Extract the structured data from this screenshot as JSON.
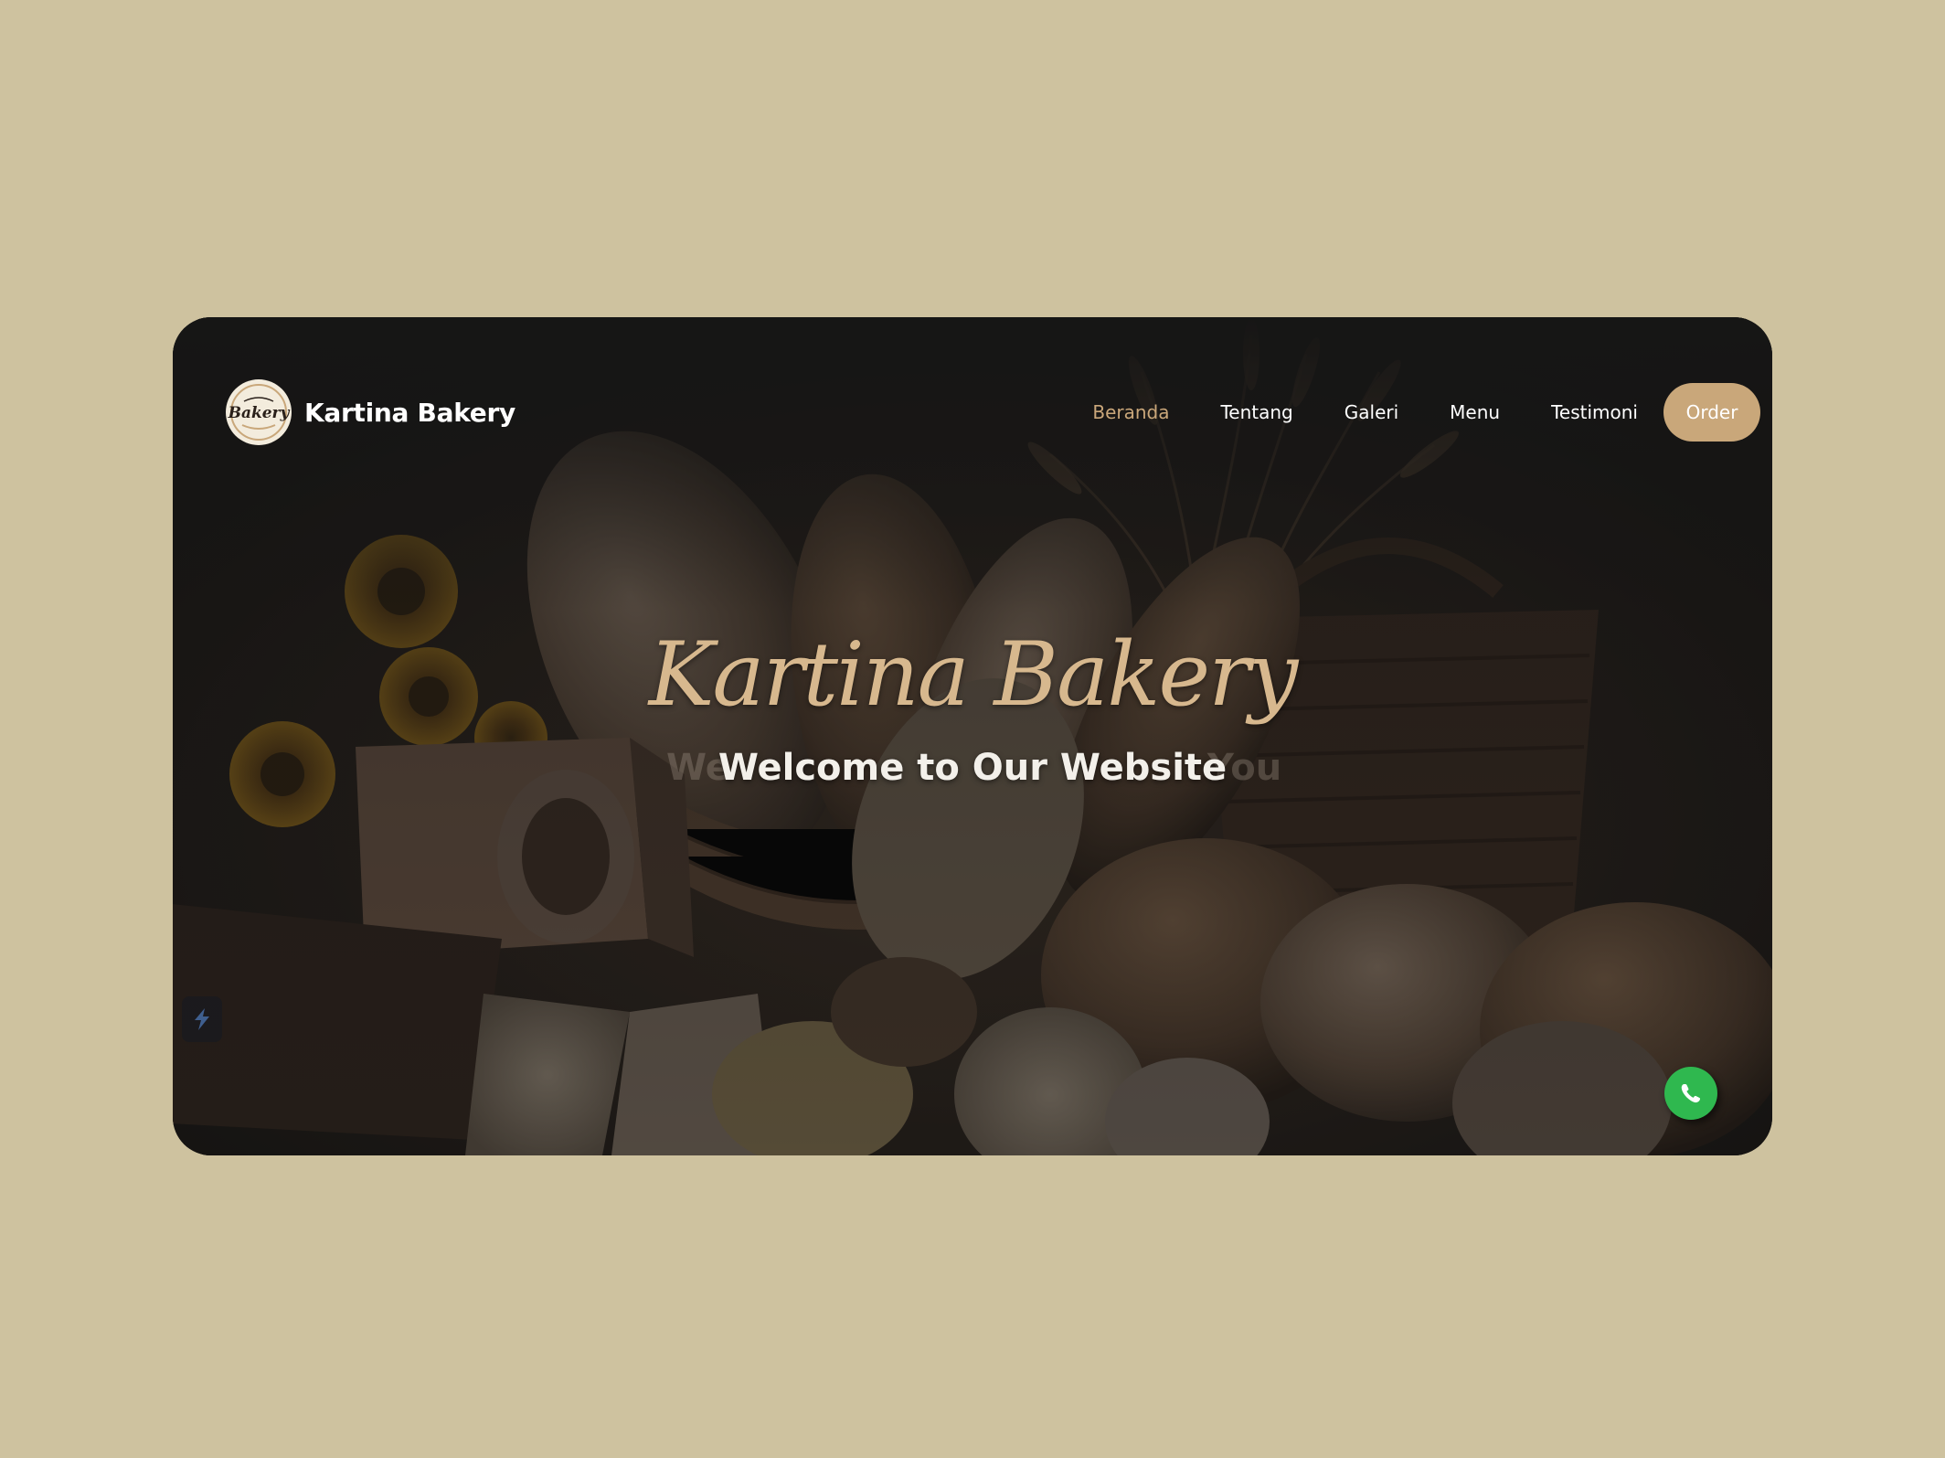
{
  "brand": {
    "name": "Kartina Bakery",
    "logo_text": "Bakery"
  },
  "nav": {
    "items": [
      {
        "label": "Beranda",
        "active": true
      },
      {
        "label": "Tentang",
        "active": false
      },
      {
        "label": "Galeri",
        "active": false
      },
      {
        "label": "Menu",
        "active": false
      },
      {
        "label": "Testimoni",
        "active": false
      }
    ],
    "order_label": "Order"
  },
  "hero": {
    "title": "Kartina Bakery",
    "subtitle": "Welcome to Our Website",
    "ghost_left": "We",
    "ghost_right": "You"
  },
  "icons": {
    "side_widget": "lightning-icon",
    "floating": "whatsapp-icon"
  },
  "colors": {
    "page_background": "#cec29f",
    "accent": "#c9a77a",
    "active_link": "#caa77a",
    "whatsapp": "#2fb84f"
  }
}
